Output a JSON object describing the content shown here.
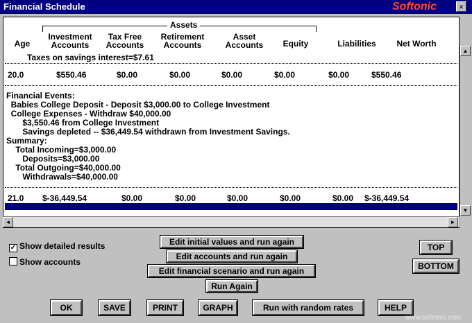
{
  "window": {
    "title": "Financial Schedule",
    "brand": "Softonic",
    "close_glyph": "×"
  },
  "table": {
    "group_header": "Assets",
    "columns": [
      "Age",
      "Investment Accounts",
      "Tax Free Accounts",
      "Retirement Accounts",
      "Asset Accounts",
      "Equity",
      "Liabilities",
      "Net Worth"
    ],
    "top_note": "Taxes on savings interest=$7.61",
    "row1": [
      "20.0",
      "$550.46",
      "$0.00",
      "$0.00",
      "$0.00",
      "$0.00",
      "$0.00",
      "$550.46"
    ],
    "events": [
      "Financial Events:",
      "  Babies College Deposit - Deposit $3,000.00 to College Investment",
      "  College Expenses - Withdraw $40,000.00",
      "       $3,550.46 from College Investment",
      "       Savings depleted -- $36,449.54 withdrawn from Investment Savings.",
      "Summary:",
      "    Total Incoming=$3,000.00",
      "       Deposits=$3,000.00",
      "    Total Outgoing=$40,000.00",
      "       Withdrawals=$40,000.00"
    ],
    "row2": [
      "21.0",
      "$-36,449.54",
      "$0.00",
      "$0.00",
      "$0.00",
      "$0.00",
      "$0.00",
      "$-36,449.54"
    ]
  },
  "options": {
    "show_detailed": {
      "label": "Show detailed results",
      "checked_mark": "✓"
    },
    "show_accounts": {
      "label": "Show accounts"
    }
  },
  "buttons": {
    "edit_initial": "Edit initial values and run again",
    "edit_accounts": "Edit accounts and run again",
    "edit_scenario": "Edit financial scenario and run again",
    "run_again": "Run Again",
    "top": "TOP",
    "bottom": "BOTTOM",
    "ok": "OK",
    "save": "SAVE",
    "print": "PRINT",
    "graph": "GRAPH",
    "random": "Run with random rates",
    "help": "HELP"
  },
  "scroll_icons": {
    "up": "▲",
    "down": "▼",
    "left": "◄",
    "right": "►"
  },
  "watermark": "www.softonic.com"
}
